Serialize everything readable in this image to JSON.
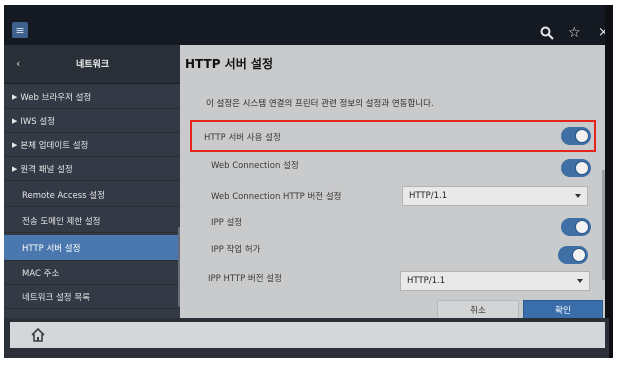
{
  "topbar": {
    "menu_icon": "hamburger-icon",
    "search_icon": "search-icon",
    "star_icon": "star-icon",
    "close_icon": "close-icon"
  },
  "sidebar": {
    "back_icon": "chevron-left-icon",
    "title": "네트워크",
    "items": [
      {
        "label": "Web 브라우저 설정",
        "arrow": "▶"
      },
      {
        "label": "IWS 설정",
        "arrow": "▶"
      },
      {
        "label": "본체 업데이트 설정",
        "arrow": "▶"
      },
      {
        "label": "원격 패널 설정",
        "arrow": "▶"
      },
      {
        "label": "Remote Access 설정",
        "arrow": ""
      },
      {
        "label": "전송 도메인 제한 설정",
        "arrow": ""
      },
      {
        "label": "HTTP 서버 설정",
        "arrow": "",
        "selected": true
      },
      {
        "label": "MAC 주소",
        "arrow": ""
      },
      {
        "label": "네트워크 설정 목록",
        "arrow": ""
      }
    ]
  },
  "panel": {
    "title": "HTTP 서버 설정",
    "description": "이 설정은 시스템 연결의 프린터 관련 정보의 설정과 연동합니다.",
    "rows": {
      "http_server_use": {
        "label": "HTTP 서버 사용 설정",
        "on": true
      },
      "web_connection": {
        "label": "Web Connection 설정",
        "on": true
      },
      "web_connection_http_version": {
        "label": "Web Connection HTTP 버전 설정",
        "value": "HTTP/1.1"
      },
      "ipp": {
        "label": "IPP 설정",
        "on": true
      },
      "ipp_job_allow": {
        "label": "IPP 작업 허가",
        "on": true
      },
      "ipp_http_version": {
        "label": "IPP HTTP 버전 설정",
        "value": "HTTP/1.1"
      }
    },
    "buttons": {
      "cancel": "취소",
      "ok": "확인"
    }
  },
  "bottom": {
    "home_icon": "home-icon"
  },
  "colors": {
    "accent": "#3f6fa5",
    "highlight": "#e2251d",
    "sidebar_bg": "#333a45",
    "panel_bg": "#c9cacb"
  }
}
